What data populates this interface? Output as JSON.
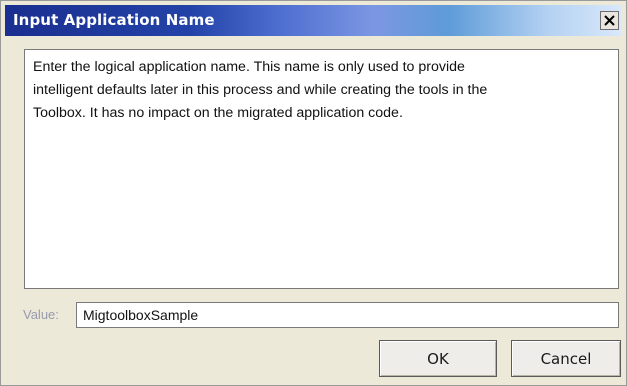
{
  "window": {
    "title": "Input Application Name",
    "close_icon": "close-icon"
  },
  "description": {
    "lines": [
      "Enter the logical application name.  This name is only used to provide",
      "intelligent defaults later in this process and while creating the tools in the",
      "Toolbox.  It has no impact on the migrated application code."
    ]
  },
  "value_field": {
    "label": "Value:",
    "value": "MigtoolboxSample"
  },
  "buttons": {
    "ok": "OK",
    "cancel": "Cancel"
  },
  "colors": {
    "titlebar_start": "#1a2f8f",
    "titlebar_end": "#d9e8fa",
    "label": "#9a9aaf"
  }
}
